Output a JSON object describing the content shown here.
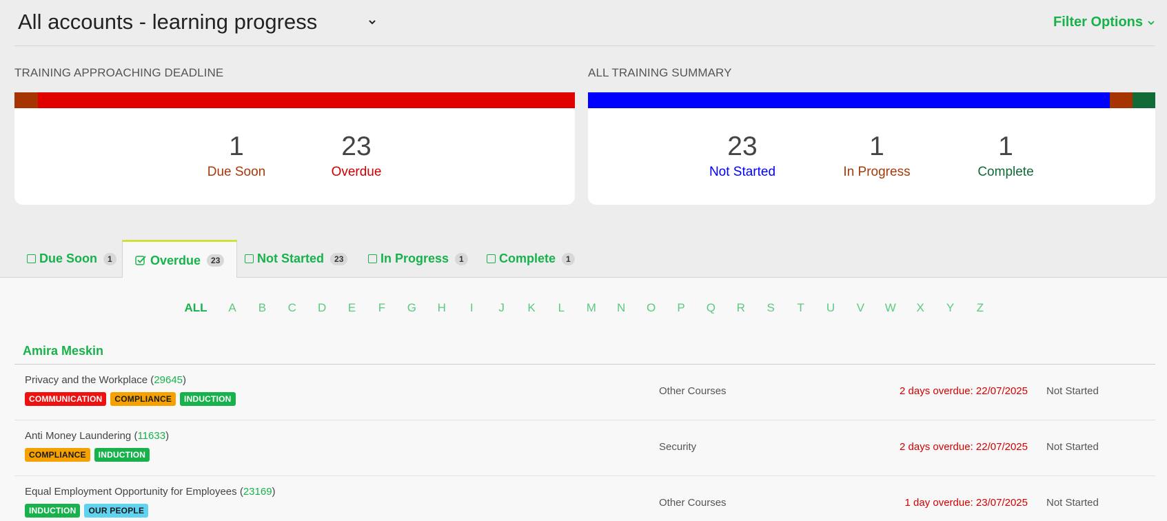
{
  "header": {
    "account_title": "All accounts - learning progress",
    "filter_label": "Filter Options"
  },
  "deadline_card": {
    "title": "TRAINING APPROACHING DEADLINE",
    "stats": [
      {
        "value": "1",
        "label": "Due Soon",
        "color": "#a63a0a"
      },
      {
        "value": "23",
        "label": "Overdue",
        "color": "#cc0000"
      }
    ],
    "bar_colors": {
      "due_soon": "#a53400",
      "overdue": "#e10000"
    }
  },
  "summary_card": {
    "title": "ALL TRAINING SUMMARY",
    "stats": [
      {
        "value": "23",
        "label": "Not Started",
        "color": "#0000ff"
      },
      {
        "value": "1",
        "label": "In Progress",
        "color": "#a63a0a"
      },
      {
        "value": "1",
        "label": "Complete",
        "color": "#0f6b37"
      }
    ],
    "bar_colors": {
      "not_started": "#0000ff",
      "in_progress": "#a53400",
      "complete": "#126b37"
    }
  },
  "tabs": [
    {
      "label": "Due Soon",
      "count": "1",
      "active": false
    },
    {
      "label": "Overdue",
      "count": "23",
      "active": true
    },
    {
      "label": "Not Started",
      "count": "23",
      "active": false
    },
    {
      "label": "In Progress",
      "count": "1",
      "active": false
    },
    {
      "label": "Complete",
      "count": "1",
      "active": false
    }
  ],
  "alphabet": [
    "ALL",
    "A",
    "B",
    "C",
    "D",
    "E",
    "F",
    "G",
    "H",
    "I",
    "J",
    "K",
    "L",
    "M",
    "N",
    "O",
    "P",
    "Q",
    "R",
    "S",
    "T",
    "U",
    "V",
    "W",
    "X",
    "Y",
    "Z"
  ],
  "person": {
    "name": "Amira Meskin"
  },
  "courses": [
    {
      "name": "Privacy and the Workplace",
      "id": "29645",
      "tags": [
        "COMMUNICATION",
        "COMPLIANCE",
        "INDUCTION"
      ],
      "category": "Other Courses",
      "due": "2 days overdue: 22/07/2025",
      "status": "Not Started"
    },
    {
      "name": "Anti Money Laundering",
      "id": "11633",
      "tags": [
        "COMPLIANCE",
        "INDUCTION"
      ],
      "category": "Security",
      "due": "2 days overdue: 22/07/2025",
      "status": "Not Started"
    },
    {
      "name": "Equal Employment Opportunity for Employees",
      "id": "23169",
      "tags": [
        "INDUCTION",
        "OUR PEOPLE"
      ],
      "category": "Other Courses",
      "due": "1 day overdue: 23/07/2025",
      "status": "Not Started"
    }
  ],
  "tag_colors": {
    "COMMUNICATION": {
      "bg": "#ee1111",
      "fg": "#ffffff"
    },
    "COMPLIANCE": {
      "bg": "#f5a100",
      "fg": "#1a1a1a"
    },
    "INDUCTION": {
      "bg": "#17b24b",
      "fg": "#ffffff"
    },
    "OUR PEOPLE": {
      "bg": "#5fd3f0",
      "fg": "#1a1a1a"
    }
  }
}
